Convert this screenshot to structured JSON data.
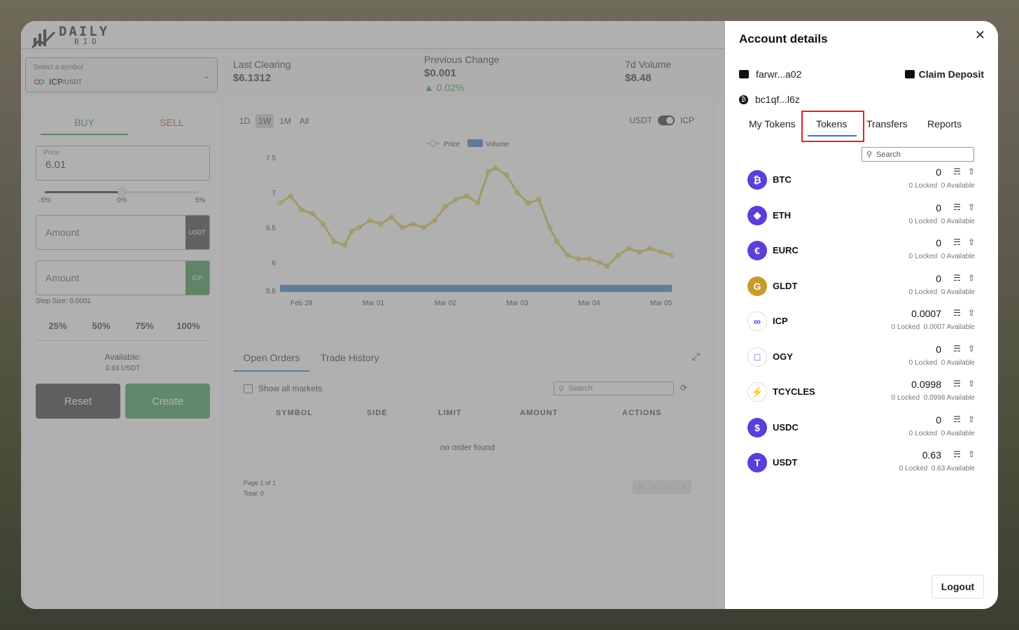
{
  "app": {
    "logo_main": "DAILY",
    "logo_sub": "BID",
    "symbol_select": {
      "label": "Select a symbol",
      "base": "ICP",
      "quote": "/USDT"
    },
    "stats": [
      {
        "label": "Last Clearing",
        "value": "$6.1312"
      },
      {
        "label": "Previous Change",
        "value": "$0.001",
        "change": "0.02%"
      },
      {
        "label": "7d Volume",
        "value": "$8.48"
      }
    ]
  },
  "order_form": {
    "buy_tab": "BUY",
    "sell_tab": "SELL",
    "price_label": "Price",
    "price_value": "6.01",
    "slider_labels": [
      "-5%",
      "0%",
      "5%"
    ],
    "slider_level_percent": 0,
    "amount_placeholder": "Amount",
    "amount_suffix_1": "USDT",
    "amount_suffix_2": "ICP",
    "step_size": "Step Size: 0.0001",
    "pct_buttons": [
      "25%",
      "50%",
      "75%",
      "100%"
    ],
    "available_label": "Available:",
    "available_value": "0.63 USDT",
    "reset_label": "Reset",
    "create_label": "Create"
  },
  "chart_panel": {
    "ranges": [
      "1D",
      "1W",
      "1M",
      "All"
    ],
    "selected_range": "1W",
    "toggle_left": "USDT",
    "toggle_right": "ICP"
  },
  "chart_data": {
    "type": "line",
    "legend": [
      "Price",
      "Volume"
    ],
    "x_ticks": [
      "Feb 28",
      "Mar 01",
      "Mar 02",
      "Mar 03",
      "Mar 04",
      "Mar 05"
    ],
    "y_ticks": [
      "7.5",
      "7",
      "6.5",
      "6",
      "5.6"
    ],
    "ylim": [
      5.55,
      7.6
    ],
    "series": [
      {
        "name": "Price",
        "color": "#d4c43a",
        "x": [
          0,
          0.15,
          0.3,
          0.45,
          0.6,
          0.75,
          0.9,
          1.0,
          1.1,
          1.25,
          1.4,
          1.55,
          1.7,
          1.85,
          2.0,
          2.15,
          2.3,
          2.45,
          2.6,
          2.75,
          2.9,
          3.0,
          3.15,
          3.3,
          3.45,
          3.6,
          3.75,
          3.85,
          4.0,
          4.15,
          4.3,
          4.45,
          4.55,
          4.7,
          4.85,
          5.0,
          5.15,
          5.3,
          5.45
        ],
        "values": [
          6.85,
          6.95,
          6.75,
          6.7,
          6.55,
          6.3,
          6.25,
          6.45,
          6.5,
          6.6,
          6.55,
          6.65,
          6.5,
          6.55,
          6.5,
          6.6,
          6.8,
          6.9,
          6.95,
          6.85,
          7.3,
          7.35,
          7.25,
          7.0,
          6.85,
          6.9,
          6.5,
          6.3,
          6.1,
          6.05,
          6.05,
          6.0,
          5.95,
          6.1,
          6.2,
          6.15,
          6.2,
          6.15,
          6.1
        ]
      },
      {
        "name": "Volume",
        "color": "#2f78c4",
        "x": [
          0,
          5.45
        ],
        "values": [
          5.6,
          5.6
        ]
      }
    ]
  },
  "orders": {
    "tab_open": "Open Orders",
    "tab_history": "Trade History",
    "show_all": "Show all markets",
    "search_placeholder": "Search",
    "columns": [
      "SYMBOL",
      "SIDE",
      "LIMIT",
      "AMOUNT",
      "ACTIONS"
    ],
    "empty": "no order found",
    "page": "Page 1 of 1",
    "total": "Total: 0"
  },
  "drawer": {
    "title": "Account details",
    "account_1": "farwr...a02",
    "account_2": "bc1qf...l6z",
    "claim_deposit": "Claim Deposit",
    "tabs": [
      "My Tokens",
      "Tokens",
      "Transfers",
      "Reports"
    ],
    "active_tab": "Tokens",
    "search_placeholder": "Search",
    "logout": "Logout",
    "tokens": [
      {
        "name": "BTC",
        "amount": "0",
        "locked": "0 Locked",
        "available": "0 Available",
        "color": "#5b3fd6"
      },
      {
        "name": "ETH",
        "amount": "0",
        "locked": "0 Locked",
        "available": "0 Available",
        "color": "#5b3fd6"
      },
      {
        "name": "EURC",
        "amount": "0",
        "locked": "0 Locked",
        "available": "0 Available",
        "color": "#5b3fd6"
      },
      {
        "name": "GLDT",
        "amount": "0",
        "locked": "0 Locked",
        "available": "0 Available",
        "color": "#c79a2b"
      },
      {
        "name": "ICP",
        "amount": "0.0007",
        "locked": "0 Locked",
        "available": "0.0007 Available",
        "color": "#ffffff"
      },
      {
        "name": "OGY",
        "amount": "0",
        "locked": "0 Locked",
        "available": "0 Available",
        "color": "#ffffff"
      },
      {
        "name": "TCYCLES",
        "amount": "0.0998",
        "locked": "0 Locked",
        "available": "0.0998 Available",
        "color": "#ffffff"
      },
      {
        "name": "USDC",
        "amount": "0",
        "locked": "0 Locked",
        "available": "0 Available",
        "color": "#5b3fd6"
      },
      {
        "name": "USDT",
        "amount": "0.63",
        "locked": "0 Locked",
        "available": "0.63 Available",
        "color": "#5b3fd6"
      }
    ]
  }
}
